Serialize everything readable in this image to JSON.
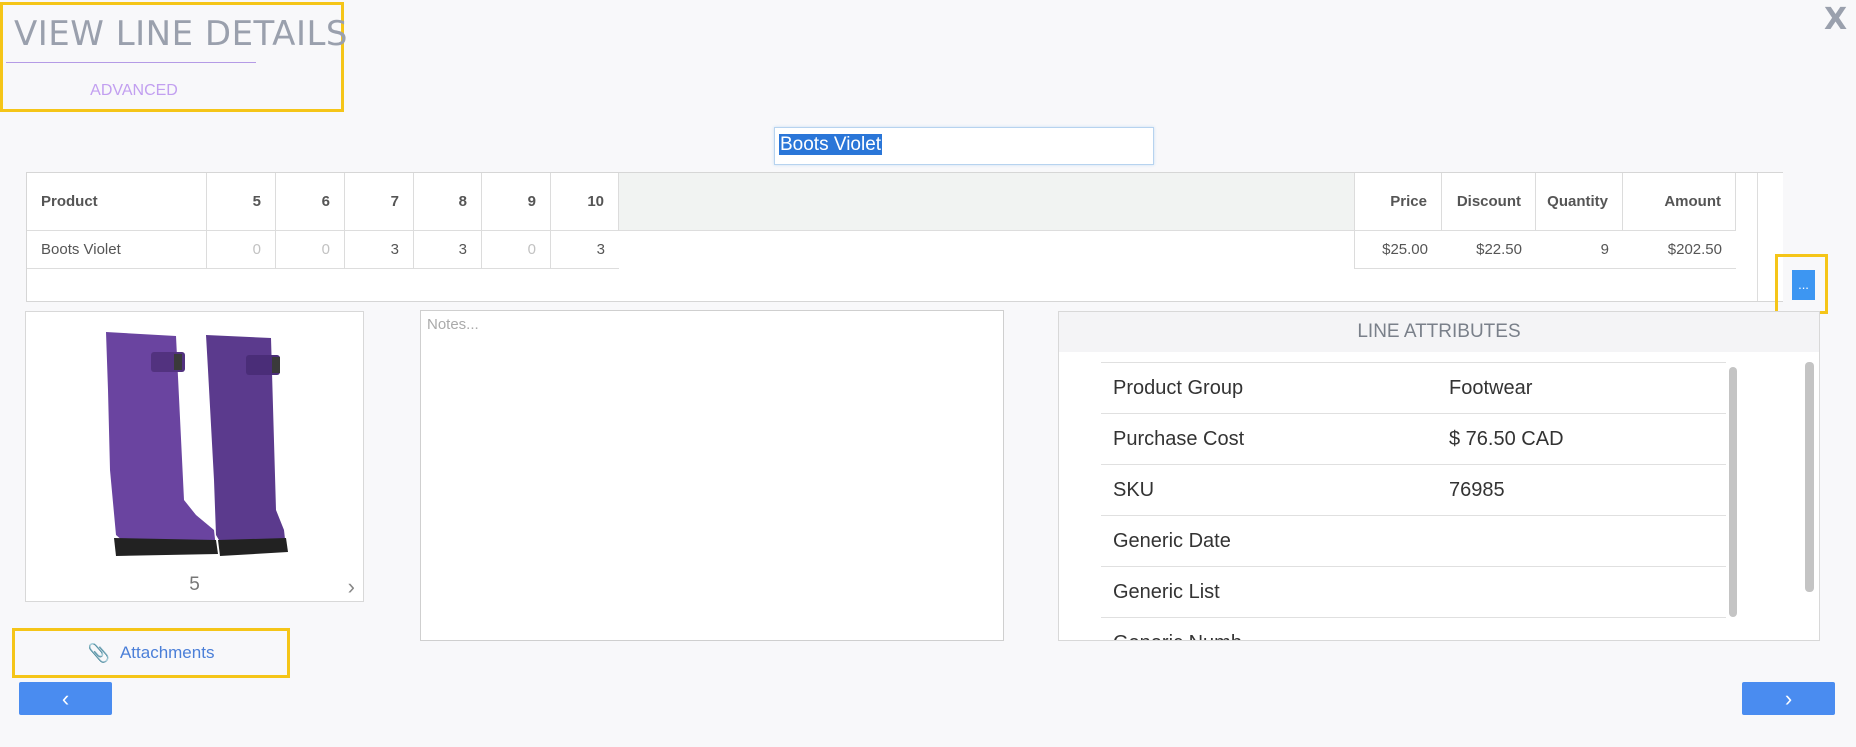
{
  "header": {
    "title": "VIEW LINE DETAILS",
    "tab_advanced": "ADVANCED",
    "close_label": "X"
  },
  "product_name": "Boots Violet",
  "grid": {
    "columns": [
      "Product",
      "5",
      "6",
      "7",
      "8",
      "9",
      "10",
      "Price",
      "Discount",
      "Quantity",
      "Amount"
    ],
    "row": {
      "product": "Boots Violet",
      "sizes": [
        "0",
        "0",
        "3",
        "3",
        "0",
        "3"
      ],
      "price": "$25.00",
      "discount": "$22.50",
      "quantity": "9",
      "amount": "$202.50"
    },
    "more_label": "..."
  },
  "image": {
    "index": "5",
    "icon": "chevron-right-icon"
  },
  "notes": {
    "placeholder": "Notes..."
  },
  "attributes": {
    "title": "LINE ATTRIBUTES",
    "rows": [
      {
        "label": "Product Group",
        "value": "Footwear"
      },
      {
        "label": "Purchase Cost",
        "value": "$ 76.50 CAD"
      },
      {
        "label": "SKU",
        "value": "76985"
      },
      {
        "label": "Generic Date",
        "value": ""
      },
      {
        "label": "Generic List",
        "value": ""
      },
      {
        "label": "Generic Numb",
        "value": ""
      }
    ]
  },
  "attachments_label": "Attachments",
  "colors": {
    "accent": "#4a8cf0",
    "highlight": "#f5c518",
    "boot": "#5a3a8a"
  }
}
